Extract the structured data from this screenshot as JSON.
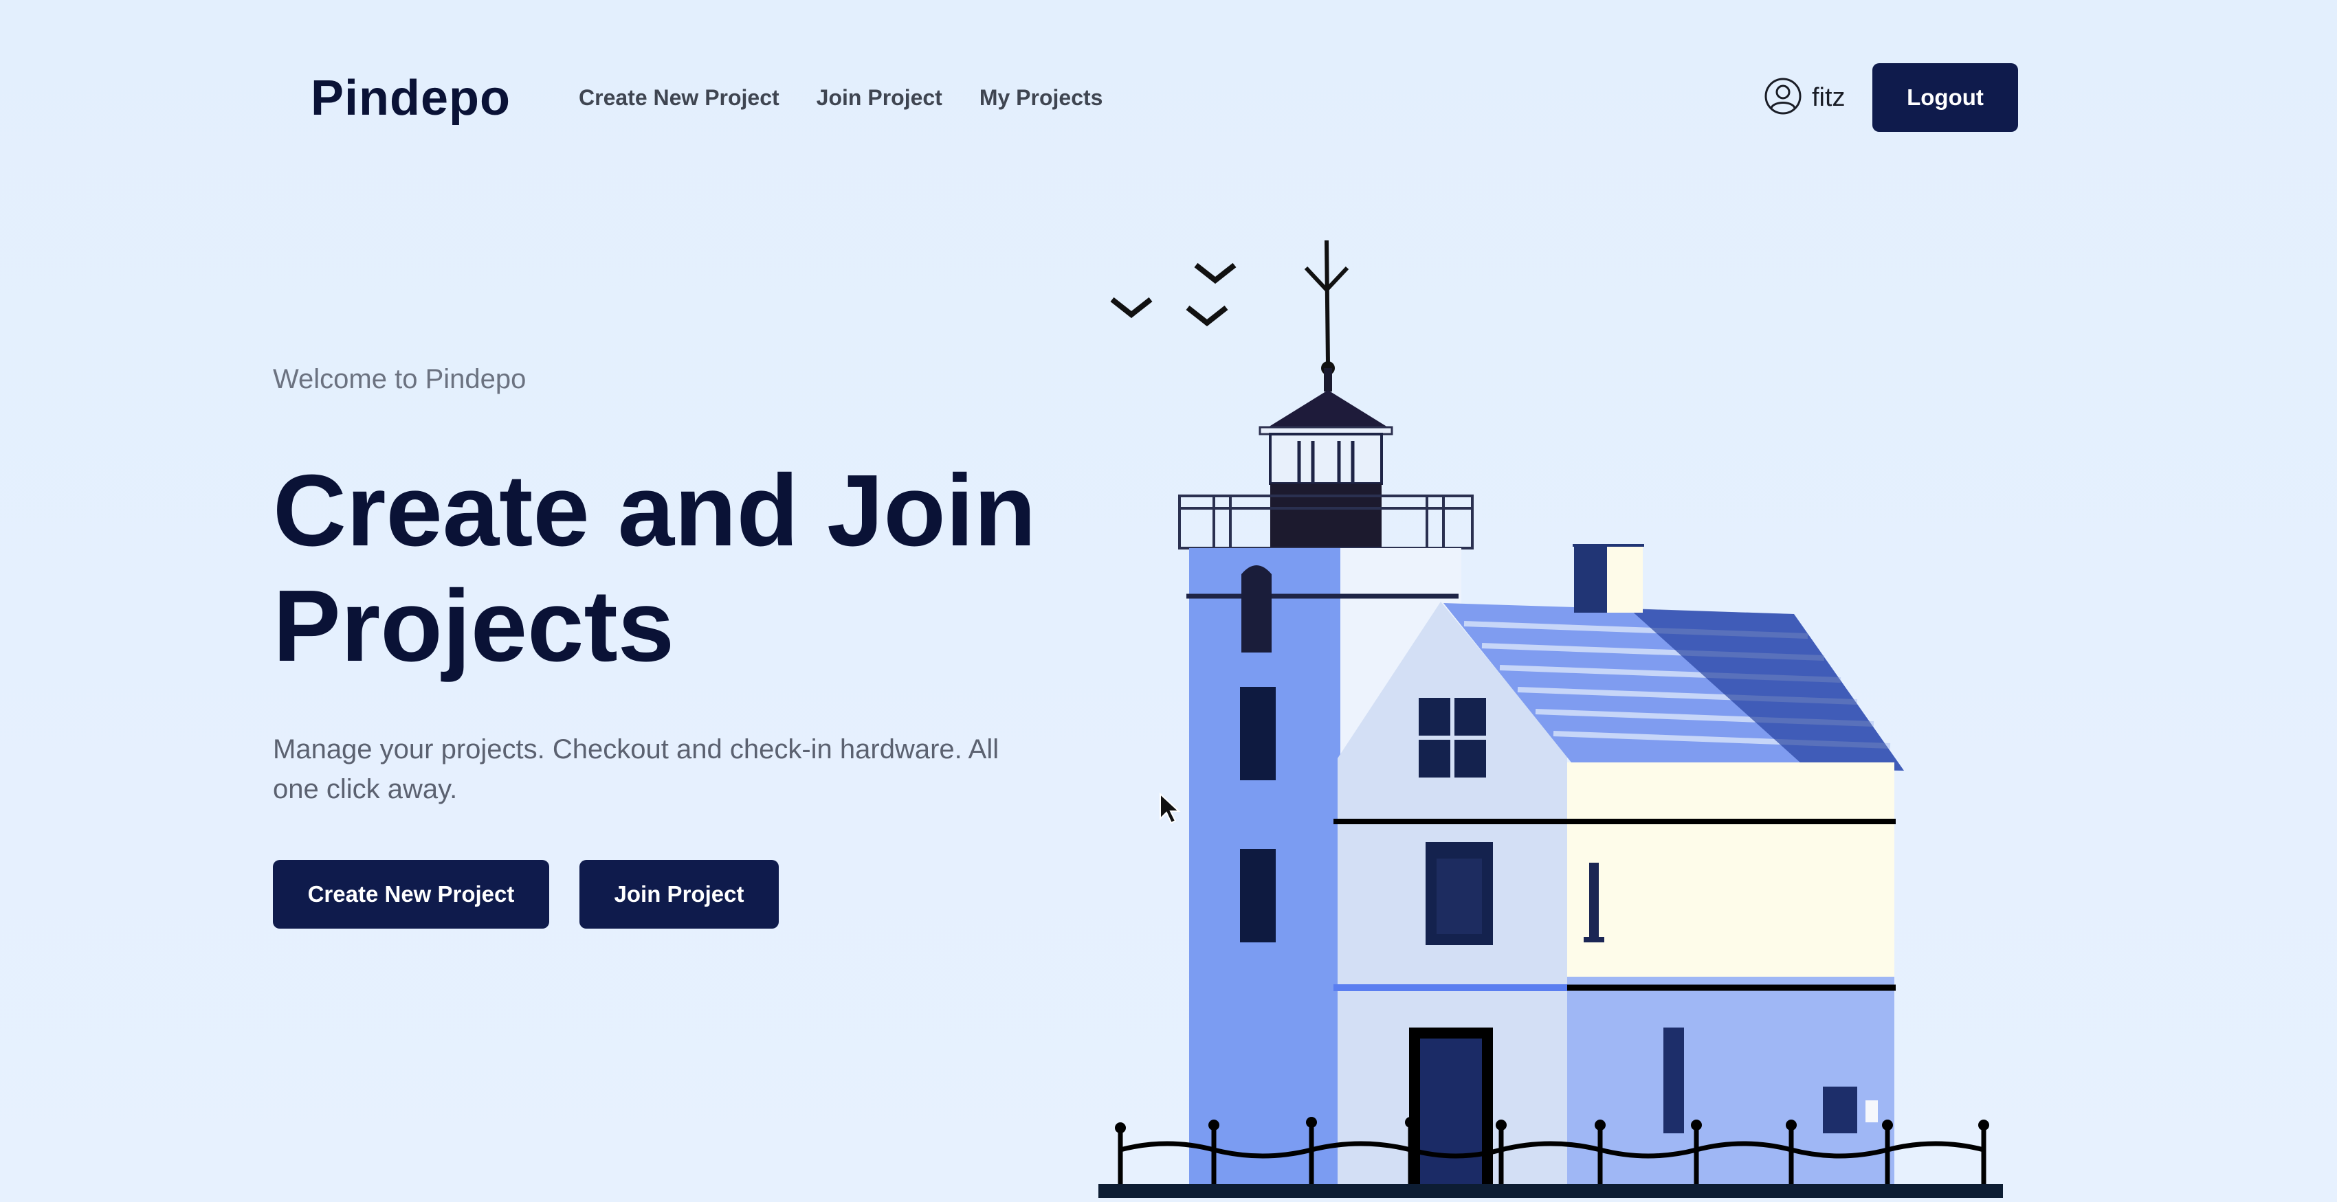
{
  "header": {
    "brand": "Pindepo",
    "nav": [
      "Create New Project",
      "Join Project",
      "My Projects"
    ],
    "username": "fitz",
    "logout_label": "Logout",
    "user_icon": "user-circle-icon"
  },
  "hero": {
    "welcome": "Welcome to Pindepo",
    "headline_line1": "Create and Join",
    "headline_line2": "Projects",
    "subtitle": "Manage your projects. Checkout and check-in hardware. All one click away.",
    "primary_button": "Create New Project",
    "secondary_button": "Join Project"
  },
  "colors": {
    "background": "#e3effd",
    "primary": "#0f1b4c",
    "heading": "#0a1236"
  }
}
